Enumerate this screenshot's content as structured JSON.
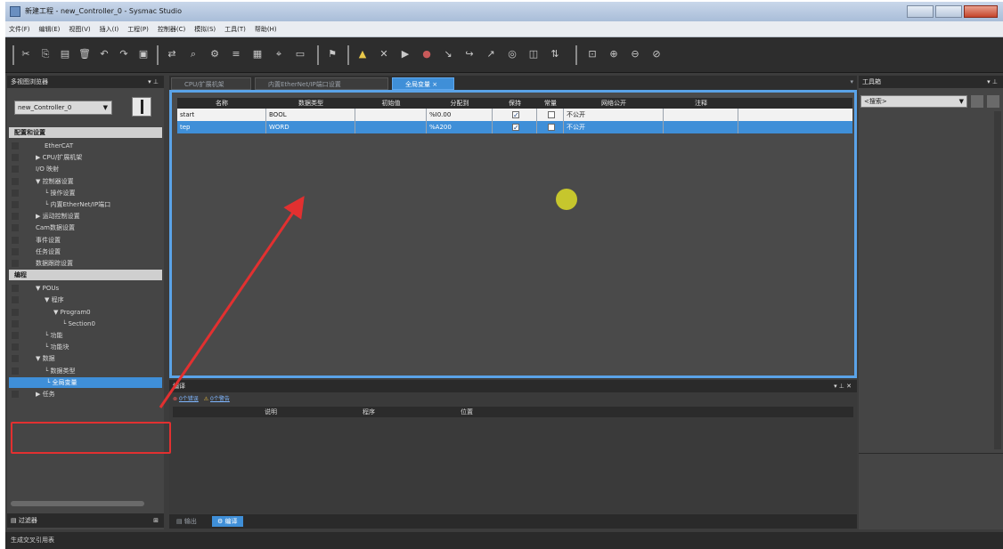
{
  "window": {
    "title": "新建工程 - new_Controller_0 - Sysmac Studio"
  },
  "menu": [
    "文件(F)",
    "编辑(E)",
    "视图(V)",
    "插入(I)",
    "工程(P)",
    "控制器(C)",
    "模拟(S)",
    "工具(T)",
    "帮助(H)"
  ],
  "left_panel": {
    "header": "多视图浏览器",
    "controller_combo": "new_Controller_0",
    "tree": [
      {
        "label": "配置和设置",
        "kind": "section"
      },
      {
        "label": "EtherCAT",
        "indent": 3
      },
      {
        "label": "▶ CPU/扩展机架",
        "indent": 2
      },
      {
        "label": "I/O 映射",
        "indent": 2
      },
      {
        "label": "▼ 控制器设置",
        "indent": 2
      },
      {
        "label": "└ 操作设置",
        "indent": 3
      },
      {
        "label": "└ 内置EtherNet/IP端口",
        "indent": 3
      },
      {
        "label": "▶ 运动控制设置",
        "indent": 2
      },
      {
        "label": "Cam数据设置",
        "indent": 2
      },
      {
        "label": "事件设置",
        "indent": 2
      },
      {
        "label": "任务设置",
        "indent": 2
      },
      {
        "label": "数据跟踪设置",
        "indent": 2
      },
      {
        "label": "编程",
        "kind": "section"
      },
      {
        "label": "▼ POUs",
        "indent": 2
      },
      {
        "label": "▼ 程序",
        "indent": 3
      },
      {
        "label": "▼ Program0",
        "indent": 4
      },
      {
        "label": "└ Section0",
        "indent": 5
      },
      {
        "label": "└ 功能",
        "indent": 3
      },
      {
        "label": "└ 功能块",
        "indent": 3
      },
      {
        "label": "▼ 数据",
        "indent": 2
      },
      {
        "label": "└ 数据类型",
        "indent": 3
      },
      {
        "label": "└ 全局变量",
        "indent": 3,
        "kind": "selected"
      },
      {
        "label": "▶ 任务",
        "indent": 2
      }
    ],
    "bottom_label": "过滤器"
  },
  "tabs": [
    {
      "label": "CPU/扩展机架",
      "active": false
    },
    {
      "label": "内置EtherNet/IP端口设置",
      "active": false
    },
    {
      "label": "全局变量 ×",
      "active": true
    }
  ],
  "variables_table": {
    "columns": [
      "名称",
      "数据类型",
      "初始值",
      "分配到",
      "保持",
      "常量",
      "网络公开",
      "注释"
    ],
    "rows": [
      {
        "name": "start",
        "type": "BOOL",
        "initial": "",
        "at": "%I0.00",
        "retain": true,
        "constant": false,
        "network": "不公开",
        "comment": ""
      },
      {
        "name": "tep",
        "type": "WORD",
        "initial": "",
        "at": "%A200",
        "retain": true,
        "constant": false,
        "network": "不公开",
        "comment": ""
      }
    ]
  },
  "output_panel": {
    "header": "编译",
    "errors_label": "0个错误",
    "warnings_label": "0个警告",
    "columns": [
      "说明",
      "程序",
      "位置"
    ]
  },
  "bottom_tabs": [
    "输出",
    "编译"
  ],
  "right_panel": {
    "header": "工具箱",
    "search_combo": "<搜索>"
  },
  "status_bar": "生成交叉引用表",
  "colors": {
    "accent": "#3f8fd8",
    "highlight": "#e23030"
  }
}
